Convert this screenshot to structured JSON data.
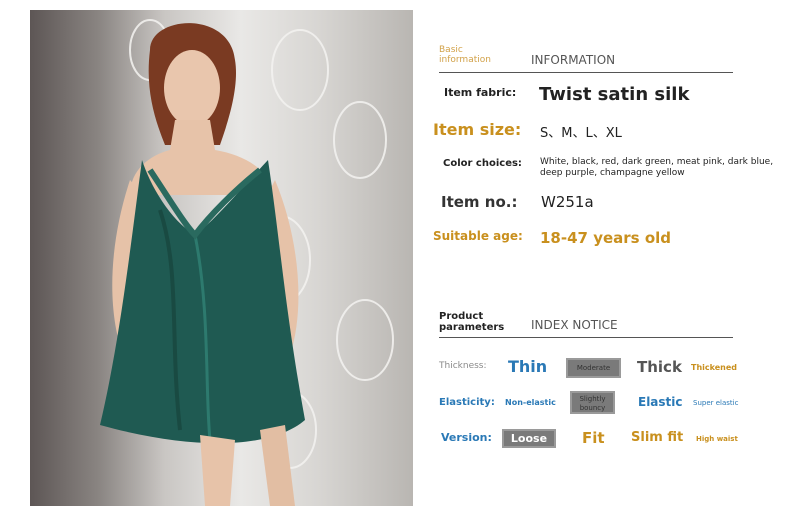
{
  "basic_section": {
    "title_small": "Basic\ninformation",
    "title_big": "INFORMATION"
  },
  "info": {
    "fabric_label": "Item fabric:",
    "fabric_value": "Twist satin silk",
    "size_label": "Item size:",
    "size_value": "S、M、L、XL",
    "color_label": "Color choices:",
    "color_value": "White, black, red, dark green, meat pink, dark blue, deep purple, champagne yellow",
    "itemno_label": "Item no.:",
    "itemno_value": "W251a",
    "age_label": "Suitable age:",
    "age_value": "18-47 years old"
  },
  "param_section": {
    "title_small": "Product\nparameters",
    "title_big": "INDEX NOTICE"
  },
  "params": {
    "thickness_label": "Thickness:",
    "thickness_opts": [
      "Thin",
      "Moderate",
      "Thick",
      "Thickened"
    ],
    "elasticity_label": "Elasticity:",
    "elasticity_opts": [
      "Non-elastic",
      "Slightly\nbouncy",
      "Elastic",
      "Super elastic"
    ],
    "version_label": "Version:",
    "version_opts": [
      "Loose",
      "Fit",
      "Slim fit",
      "High waist"
    ]
  },
  "colors": {
    "gold": "#c9901e",
    "blue": "#2a79b6",
    "dress_green": "#1f5a52"
  }
}
